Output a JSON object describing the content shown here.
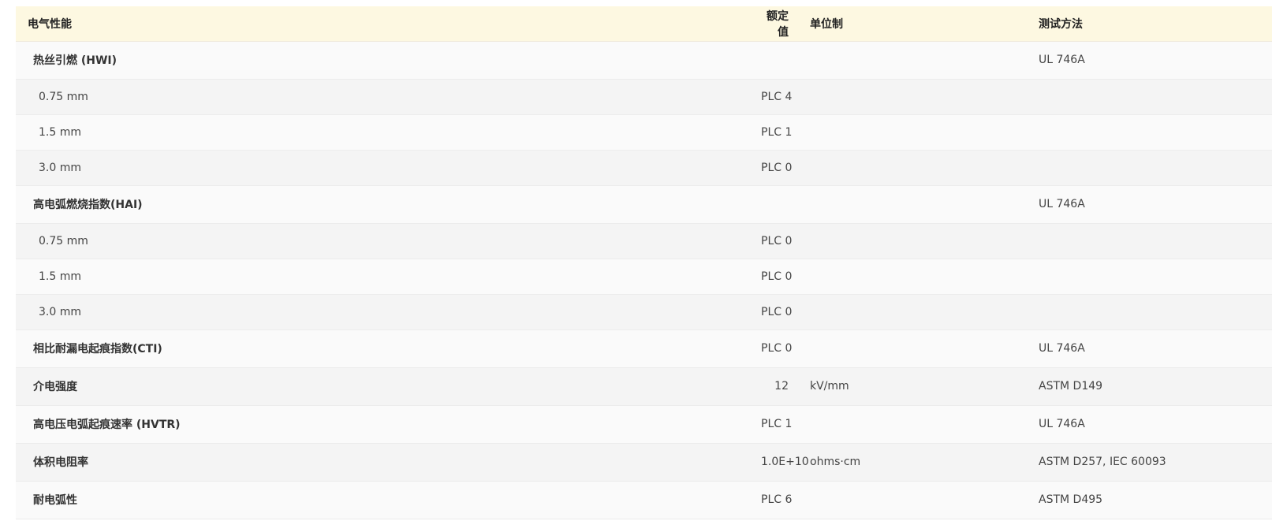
{
  "table": {
    "headers": {
      "property": "电气性能",
      "value": "额定值",
      "unit": "单位制",
      "method": "测试方法"
    },
    "rows": [
      {
        "kind": "group",
        "property": "热丝引燃 (HWI)",
        "value": "",
        "unit": "",
        "method": "UL 746A"
      },
      {
        "kind": "sub",
        "property": "0.75 mm",
        "value": "PLC 4",
        "unit": "",
        "method": ""
      },
      {
        "kind": "sub",
        "property": "1.5 mm",
        "value": "PLC 1",
        "unit": "",
        "method": ""
      },
      {
        "kind": "sub",
        "property": "3.0 mm",
        "value": "PLC 0",
        "unit": "",
        "method": ""
      },
      {
        "kind": "group",
        "property": "高电弧燃烧指数(HAI)",
        "value": "",
        "unit": "",
        "method": "UL 746A"
      },
      {
        "kind": "sub",
        "property": "0.75 mm",
        "value": "PLC 0",
        "unit": "",
        "method": ""
      },
      {
        "kind": "sub",
        "property": "1.5 mm",
        "value": "PLC 0",
        "unit": "",
        "method": ""
      },
      {
        "kind": "sub",
        "property": "3.0 mm",
        "value": "PLC 0",
        "unit": "",
        "method": ""
      },
      {
        "kind": "group",
        "property": "相比耐漏电起痕指数(CTI)",
        "value": "PLC 0",
        "unit": "",
        "method": "UL 746A"
      },
      {
        "kind": "group",
        "property": "介电强度",
        "value": "12",
        "unit": "kV/mm",
        "method": "ASTM D149"
      },
      {
        "kind": "group",
        "property": "高电压电弧起痕速率 (HVTR)",
        "value": "PLC 1",
        "unit": "",
        "method": "UL 746A"
      },
      {
        "kind": "group",
        "property": "体积电阻率",
        "value": "1.0E+10",
        "unit": "ohms·cm",
        "method": "ASTM D257, IEC 60093"
      },
      {
        "kind": "group",
        "property": "耐电弧性",
        "value": "PLC 6",
        "unit": "",
        "method": "ASTM D495"
      }
    ]
  }
}
